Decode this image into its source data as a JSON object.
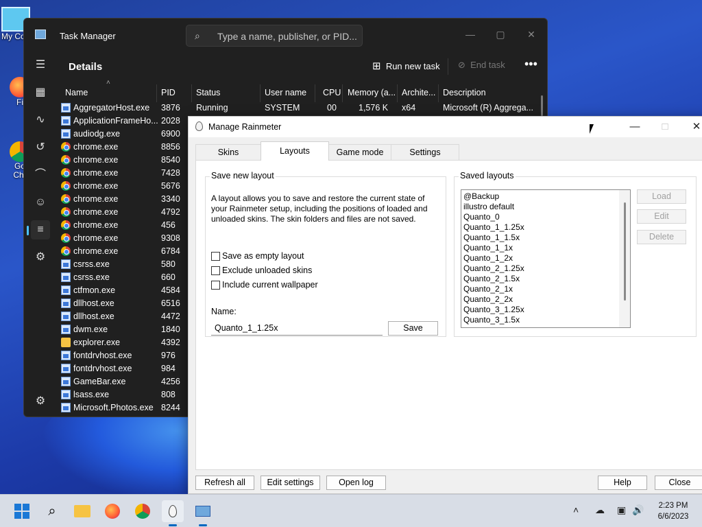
{
  "desktop": {
    "icons": [
      "My Co",
      "Fi",
      "Go\nChr"
    ]
  },
  "task_manager": {
    "title": "Task Manager",
    "search_placeholder": "Type a name, publisher, or PID...",
    "section": "Details",
    "run_new_task": "Run new task",
    "end_task": "End task",
    "more": "•••",
    "columns": [
      "Name",
      "PID",
      "Status",
      "User name",
      "CPU",
      "Memory (a...",
      "Archite...",
      "Description"
    ],
    "first_row": {
      "status": "Running",
      "user": "SYSTEM",
      "cpu": "00",
      "memory": "1,576 K",
      "arch": "x64",
      "description": "Microsoft (R) Aggrega..."
    },
    "processes": [
      {
        "name": "AggregatorHost.exe",
        "pid": "3876",
        "icon": "exe"
      },
      {
        "name": "ApplicationFrameHo...",
        "pid": "2028",
        "icon": "exe"
      },
      {
        "name": "audiodg.exe",
        "pid": "6900",
        "icon": "exe"
      },
      {
        "name": "chrome.exe",
        "pid": "8856",
        "icon": "chrome"
      },
      {
        "name": "chrome.exe",
        "pid": "8540",
        "icon": "chrome"
      },
      {
        "name": "chrome.exe",
        "pid": "7428",
        "icon": "chrome"
      },
      {
        "name": "chrome.exe",
        "pid": "5676",
        "icon": "chrome"
      },
      {
        "name": "chrome.exe",
        "pid": "3340",
        "icon": "chrome"
      },
      {
        "name": "chrome.exe",
        "pid": "4792",
        "icon": "chrome"
      },
      {
        "name": "chrome.exe",
        "pid": "456",
        "icon": "chrome"
      },
      {
        "name": "chrome.exe",
        "pid": "9308",
        "icon": "chrome"
      },
      {
        "name": "chrome.exe",
        "pid": "6784",
        "icon": "chrome"
      },
      {
        "name": "csrss.exe",
        "pid": "580",
        "icon": "exe"
      },
      {
        "name": "csrss.exe",
        "pid": "660",
        "icon": "exe"
      },
      {
        "name": "ctfmon.exe",
        "pid": "4584",
        "icon": "exe"
      },
      {
        "name": "dllhost.exe",
        "pid": "6516",
        "icon": "exe"
      },
      {
        "name": "dllhost.exe",
        "pid": "4472",
        "icon": "exe"
      },
      {
        "name": "dwm.exe",
        "pid": "1840",
        "icon": "exe"
      },
      {
        "name": "explorer.exe",
        "pid": "4392",
        "icon": "folder"
      },
      {
        "name": "fontdrvhost.exe",
        "pid": "976",
        "icon": "exe"
      },
      {
        "name": "fontdrvhost.exe",
        "pid": "984",
        "icon": "exe"
      },
      {
        "name": "GameBar.exe",
        "pid": "4256",
        "icon": "exe"
      },
      {
        "name": "lsass.exe",
        "pid": "808",
        "icon": "exe"
      },
      {
        "name": "Microsoft.Photos.exe",
        "pid": "8244",
        "icon": "exe"
      }
    ]
  },
  "rainmeter": {
    "title": "Manage Rainmeter",
    "tabs": [
      "Skins",
      "Layouts",
      "Game mode",
      "Settings"
    ],
    "active_tab": "Layouts",
    "save_group": {
      "label": "Save new layout",
      "description": "A layout allows you to save and restore the current state of your Rainmeter setup, including the positions of loaded and unloaded skins. The skin folders and files are not saved.",
      "options": [
        "Save as empty layout",
        "Exclude unloaded skins",
        "Include current wallpaper"
      ],
      "name_label": "Name:",
      "name_value": "Quanto_1_1.25x",
      "save_button": "Save"
    },
    "saved_group": {
      "label": "Saved layouts",
      "layouts": [
        "@Backup",
        "illustro default",
        "Quanto_0",
        "Quanto_1_1.25x",
        "Quanto_1_1.5x",
        "Quanto_1_1x",
        "Quanto_1_2x",
        "Quanto_2_1.25x",
        "Quanto_2_1.5x",
        "Quanto_2_1x",
        "Quanto_2_2x",
        "Quanto_3_1.25x",
        "Quanto_3_1.5x"
      ],
      "buttons": [
        "Load",
        "Edit",
        "Delete"
      ]
    },
    "bottom_buttons": {
      "refresh": "Refresh all",
      "edit_settings": "Edit settings",
      "open_log": "Open log",
      "help": "Help",
      "close": "Close"
    }
  },
  "taskbar": {
    "time": "2:23 PM",
    "date": "6/6/2023"
  }
}
